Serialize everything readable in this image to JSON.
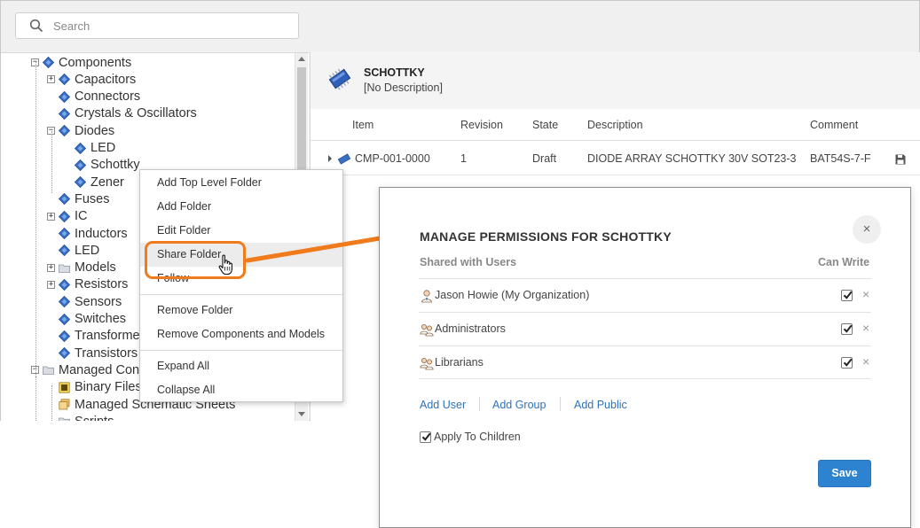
{
  "search": {
    "placeholder": "Search"
  },
  "tree": {
    "items": [
      {
        "label": "Components",
        "icon": "category-icon",
        "expander": "−"
      },
      {
        "label": "Capacitors",
        "icon": "category-icon",
        "expander": "+"
      },
      {
        "label": "Connectors",
        "icon": "category-icon",
        "expander": ""
      },
      {
        "label": "Crystals & Oscillators",
        "icon": "category-icon",
        "expander": ""
      },
      {
        "label": "Diodes",
        "icon": "category-icon",
        "expander": "−"
      },
      {
        "label": "LED",
        "icon": "category-icon",
        "expander": ""
      },
      {
        "label": "Schottky",
        "icon": "category-icon",
        "expander": ""
      },
      {
        "label": "Zener",
        "icon": "category-icon",
        "expander": ""
      },
      {
        "label": "Fuses",
        "icon": "category-icon",
        "expander": ""
      },
      {
        "label": "IC",
        "icon": "category-icon",
        "expander": "+"
      },
      {
        "label": "Inductors",
        "icon": "category-icon",
        "expander": ""
      },
      {
        "label": "LED",
        "icon": "category-icon",
        "expander": ""
      },
      {
        "label": "Models",
        "icon": "folder-icon",
        "expander": "+"
      },
      {
        "label": "Resistors",
        "icon": "category-icon",
        "expander": "+"
      },
      {
        "label": "Sensors",
        "icon": "category-icon",
        "expander": ""
      },
      {
        "label": "Switches",
        "icon": "category-icon",
        "expander": ""
      },
      {
        "label": "Transformers",
        "icon": "category-icon",
        "expander": ""
      },
      {
        "label": "Transistors",
        "icon": "category-icon",
        "expander": ""
      },
      {
        "label": "Managed Content",
        "icon": "folder-icon",
        "expander": "−"
      },
      {
        "label": "Binary Files",
        "icon": "binary-files-icon",
        "expander": ""
      },
      {
        "label": "Managed Schematic Sheets",
        "icon": "schematic-sheets-icon",
        "expander": ""
      },
      {
        "label": "Scripts",
        "icon": "folder-icon",
        "expander": ""
      }
    ]
  },
  "context_menu": {
    "items": [
      {
        "label": "Add Top Level Folder"
      },
      {
        "label": "Add Folder"
      },
      {
        "label": "Edit Folder"
      },
      {
        "label": "Share Folder"
      },
      {
        "label": "Follow"
      },
      {
        "label": "Remove Folder"
      },
      {
        "label": "Remove Components and Models"
      },
      {
        "label": "Expand All"
      },
      {
        "label": "Collapse All"
      }
    ]
  },
  "details": {
    "name": "SCHOTTKY",
    "description": "[No Description]",
    "columns": [
      "Item",
      "Revision",
      "State",
      "Description",
      "Comment"
    ],
    "rows": [
      {
        "item": "CMP-001-0000",
        "revision": "1",
        "state": "Draft",
        "description": "DIODE ARRAY SCHOTTKY 30V SOT23-3",
        "comment": "BAT54S-7-F"
      }
    ]
  },
  "dialog": {
    "title": "MANAGE PERMISSIONS FOR SCHOTTKY",
    "close_glyph": "×",
    "col_users": "Shared with Users",
    "col_write": "Can Write",
    "entries": [
      {
        "name": "Jason Howie (My Organization)",
        "icon": "user-icon",
        "can_write": true
      },
      {
        "name": "Administrators",
        "icon": "group-icon",
        "can_write": true
      },
      {
        "name": "Librarians",
        "icon": "group-icon",
        "can_write": true
      }
    ],
    "remove_glyph": "×",
    "add_user": "Add User",
    "add_group": "Add Group",
    "add_public": "Add Public",
    "apply_to_children": "Apply To Children",
    "apply_checked": true,
    "save": "Save"
  },
  "colors": {
    "highlight_orange": "#f07b1c",
    "link_blue": "#2f72b8",
    "save_blue": "#2d83d0"
  }
}
